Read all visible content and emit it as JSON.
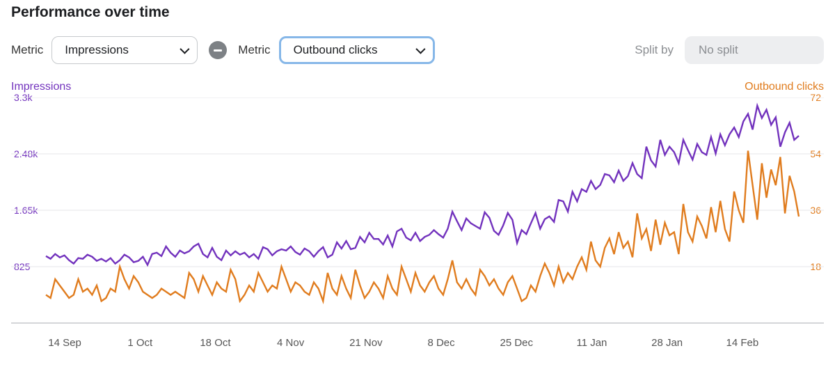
{
  "title": "Performance over time",
  "controls": {
    "metric_label": "Metric",
    "metric1_value": "Impressions",
    "metric2_value": "Outbound clicks",
    "split_label": "Split by",
    "split_value": "No split"
  },
  "legend": {
    "left": "Impressions",
    "right": "Outbound clicks"
  },
  "chart_data": {
    "type": "line",
    "x_ticks": [
      "14 Sep",
      "1 Oct",
      "18 Oct",
      "4 Nov",
      "21 Nov",
      "8 Dec",
      "25 Dec",
      "11 Jan",
      "28 Jan",
      "14 Feb"
    ],
    "y_left_ticks": [
      "3.3k",
      "2.48k",
      "1.65k",
      "825"
    ],
    "y_right_ticks": [
      "72",
      "54",
      "36",
      "18"
    ],
    "y_left_range": [
      0,
      3300
    ],
    "y_right_range": [
      0,
      72
    ],
    "x_count": 164,
    "series": [
      {
        "name": "Impressions",
        "axis": "left",
        "color": "#7232bd",
        "values": [
          980,
          940,
          1010,
          960,
          990,
          920,
          870,
          950,
          940,
          1000,
          970,
          910,
          940,
          900,
          950,
          870,
          920,
          1000,
          960,
          890,
          910,
          970,
          850,
          1010,
          1030,
          980,
          1120,
          1030,
          970,
          1060,
          1020,
          1050,
          1120,
          1160,
          1010,
          960,
          1100,
          970,
          920,
          1060,
          990,
          1050,
          1000,
          1030,
          960,
          1010,
          940,
          1110,
          1080,
          990,
          1050,
          1080,
          1060,
          1120,
          1040,
          1000,
          1090,
          1050,
          970,
          1050,
          1110,
          960,
          1000,
          1180,
          1090,
          1200,
          1080,
          1100,
          1260,
          1180,
          1320,
          1230,
          1230,
          1150,
          1280,
          1120,
          1340,
          1380,
          1250,
          1210,
          1320,
          1200,
          1260,
          1290,
          1360,
          1300,
          1250,
          1380,
          1630,
          1490,
          1360,
          1530,
          1460,
          1420,
          1380,
          1620,
          1540,
          1350,
          1290,
          1430,
          1610,
          1510,
          1170,
          1360,
          1300,
          1460,
          1610,
          1380,
          1520,
          1560,
          1480,
          1800,
          1780,
          1630,
          1920,
          1780,
          1960,
          1920,
          2080,
          1960,
          2020,
          2180,
          2160,
          2060,
          2230,
          2080,
          2150,
          2340,
          2180,
          2120,
          2580,
          2380,
          2290,
          2680,
          2460,
          2580,
          2500,
          2340,
          2680,
          2530,
          2390,
          2620,
          2500,
          2460,
          2720,
          2480,
          2760,
          2600,
          2760,
          2860,
          2720,
          2950,
          3060,
          2830,
          3180,
          3000,
          3120,
          2900,
          3010,
          2580,
          2790,
          2930,
          2680,
          2740
        ]
      },
      {
        "name": "Outbound clicks",
        "axis": "right",
        "color": "#e07c1e",
        "values": [
          9,
          8,
          14,
          12,
          10,
          8,
          9,
          14,
          10,
          11,
          9,
          12,
          7,
          8,
          11,
          10,
          18,
          14,
          11,
          15,
          13,
          10,
          9,
          8,
          9,
          11,
          10,
          9,
          10,
          9,
          8,
          16,
          14,
          10,
          15,
          12,
          9,
          13,
          11,
          10,
          17,
          14,
          7,
          9,
          12,
          10,
          16,
          13,
          10,
          12,
          11,
          18,
          14,
          10,
          13,
          12,
          10,
          9,
          13,
          11,
          7,
          16,
          11,
          9,
          15,
          11,
          8,
          17,
          12,
          8,
          10,
          13,
          11,
          8,
          15,
          11,
          9,
          18,
          14,
          10,
          16,
          12,
          10,
          13,
          15,
          11,
          9,
          14,
          20,
          13,
          11,
          14,
          11,
          9,
          17,
          15,
          12,
          14,
          11,
          9,
          13,
          15,
          11,
          7,
          8,
          12,
          10,
          15,
          19,
          16,
          12,
          18,
          13,
          16,
          14,
          18,
          21,
          17,
          26,
          20,
          18,
          24,
          27,
          22,
          29,
          24,
          26,
          21,
          35,
          27,
          30,
          23,
          33,
          25,
          32,
          28,
          29,
          22,
          38,
          29,
          26,
          34,
          31,
          27,
          37,
          29,
          39,
          30,
          26,
          42,
          36,
          32,
          55,
          44,
          33,
          51,
          40,
          49,
          44,
          53,
          35,
          47,
          42,
          34
        ]
      }
    ]
  }
}
